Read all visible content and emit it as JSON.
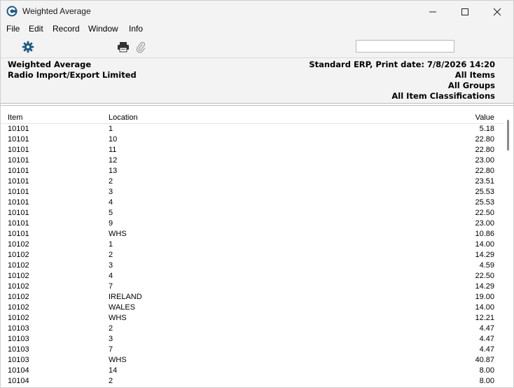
{
  "window": {
    "title": "Weighted Average"
  },
  "menu": {
    "file": "File",
    "edit": "Edit",
    "record": "Record",
    "window": "Window",
    "info": "Info"
  },
  "toolbar": {
    "search_value": ""
  },
  "report": {
    "title": "Weighted Average",
    "company": "Radio Import/Export Limited",
    "print_line": "Standard ERP, Print date: 7/8/2026 14:20",
    "filter_items": "All Items",
    "filter_groups": "All Groups",
    "filter_classifications": "All Item Classifications",
    "columns": {
      "item": "Item",
      "location": "Location",
      "value": "Value"
    },
    "rows": [
      {
        "item": "10101",
        "location": "1",
        "value": "5.18"
      },
      {
        "item": "10101",
        "location": "10",
        "value": "22.80"
      },
      {
        "item": "10101",
        "location": "11",
        "value": "22.80"
      },
      {
        "item": "10101",
        "location": "12",
        "value": "23.00"
      },
      {
        "item": "10101",
        "location": "13",
        "value": "22.80"
      },
      {
        "item": "10101",
        "location": "2",
        "value": "23.51"
      },
      {
        "item": "10101",
        "location": "3",
        "value": "25.53"
      },
      {
        "item": "10101",
        "location": "4",
        "value": "25.53"
      },
      {
        "item": "10101",
        "location": "5",
        "value": "22.50"
      },
      {
        "item": "10101",
        "location": "9",
        "value": "23.00"
      },
      {
        "item": "10101",
        "location": "WHS",
        "value": "10.86"
      },
      {
        "item": "10102",
        "location": "1",
        "value": "14.00"
      },
      {
        "item": "10102",
        "location": "2",
        "value": "14.29"
      },
      {
        "item": "10102",
        "location": "3",
        "value": "4.59"
      },
      {
        "item": "10102",
        "location": "4",
        "value": "22.50"
      },
      {
        "item": "10102",
        "location": "7",
        "value": "14.29"
      },
      {
        "item": "10102",
        "location": "IRELAND",
        "value": "19.00"
      },
      {
        "item": "10102",
        "location": "WALES",
        "value": "14.00"
      },
      {
        "item": "10102",
        "location": "WHS",
        "value": "12.21"
      },
      {
        "item": "10103",
        "location": "2",
        "value": "4.47"
      },
      {
        "item": "10103",
        "location": "3",
        "value": "4.47"
      },
      {
        "item": "10103",
        "location": "7",
        "value": "4.47"
      },
      {
        "item": "10103",
        "location": "WHS",
        "value": "40.87"
      },
      {
        "item": "10104",
        "location": "14",
        "value": "8.00"
      },
      {
        "item": "10104",
        "location": "2",
        "value": "8.00"
      }
    ]
  },
  "colors": {
    "chrome": "#f3f3f3",
    "icon_blue": "#1f5a85",
    "separator": "#bdbdbd"
  },
  "icons": [
    "app-icon",
    "minimize-icon",
    "maximize-icon",
    "close-icon",
    "gear-icon",
    "print-icon",
    "paperclip-icon"
  ]
}
